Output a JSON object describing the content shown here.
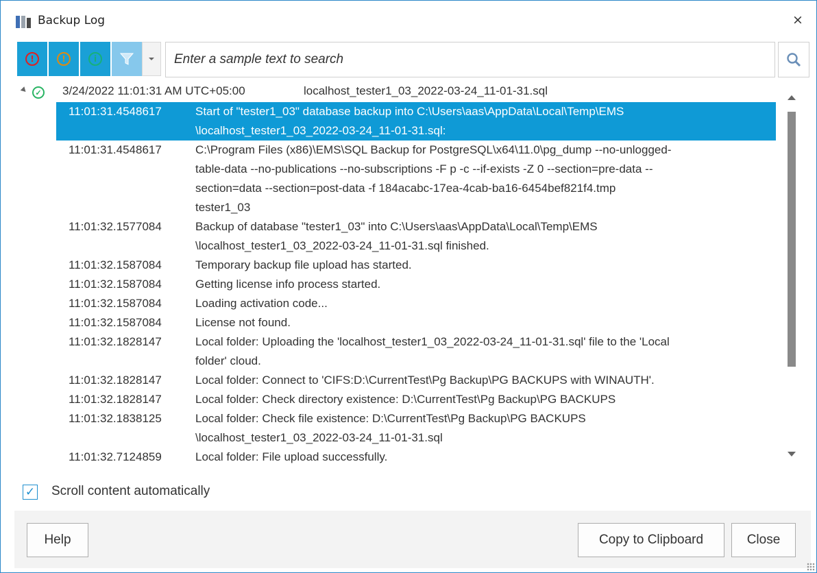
{
  "window": {
    "title": "Backup Log",
    "close_glyph": "×"
  },
  "toolbar": {
    "filters": [
      {
        "name": "error-filter-icon",
        "glyph": "!",
        "color": "#e02020"
      },
      {
        "name": "warning-filter-icon",
        "glyph": "!",
        "color": "#e08a10"
      },
      {
        "name": "info-filter-icon",
        "glyph": "i",
        "color": "#17b07a"
      }
    ],
    "search_placeholder": "Enter a sample text to search"
  },
  "log": {
    "group": {
      "date": "3/24/2022 11:01:31 AM UTC+05:00",
      "file": "localhost_tester1_03_2022-03-24_11-01-31.sql",
      "status": "success"
    },
    "entries": [
      {
        "time": "11:01:31.4548617",
        "selected": true,
        "lines": [
          "Start of \"tester1_03\" database backup into C:\\Users\\aas\\AppData\\Local\\Temp\\EMS",
          "\\localhost_tester1_03_2022-03-24_11-01-31.sql:"
        ]
      },
      {
        "time": "11:01:31.4548617",
        "lines": [
          "C:\\Program Files (x86)\\EMS\\SQL Backup for PostgreSQL\\x64\\11.0\\pg_dump --no-unlogged-",
          "table-data --no-publications --no-subscriptions -F p -c --if-exists -Z 0 --section=pre-data --",
          "section=data --section=post-data -f 184acabc-17ea-4cab-ba16-6454bef821f4.tmp",
          "tester1_03"
        ]
      },
      {
        "time": "11:01:32.1577084",
        "lines": [
          "Backup of database \"tester1_03\" into C:\\Users\\aas\\AppData\\Local\\Temp\\EMS",
          "\\localhost_tester1_03_2022-03-24_11-01-31.sql finished."
        ]
      },
      {
        "time": "11:01:32.1587084",
        "lines": [
          "Temporary backup file upload has started."
        ]
      },
      {
        "time": "11:01:32.1587084",
        "lines": [
          "Getting license info process started."
        ]
      },
      {
        "time": "11:01:32.1587084",
        "lines": [
          "Loading activation code..."
        ]
      },
      {
        "time": "11:01:32.1587084",
        "lines": [
          "License not found."
        ]
      },
      {
        "time": "11:01:32.1828147",
        "lines": [
          "Local folder: Uploading the 'localhost_tester1_03_2022-03-24_11-01-31.sql' file to the 'Local",
          "folder' cloud."
        ]
      },
      {
        "time": "11:01:32.1828147",
        "lines": [
          "Local folder: Connect to 'CIFS:D:\\CurrentTest\\Pg Backup\\PG BACKUPS with WINAUTH'."
        ]
      },
      {
        "time": "11:01:32.1828147",
        "lines": [
          "Local folder: Check directory existence: D:\\CurrentTest\\Pg Backup\\PG BACKUPS"
        ]
      },
      {
        "time": "11:01:32.1838125",
        "lines": [
          "Local folder: Check file existence: D:\\CurrentTest\\Pg Backup\\PG BACKUPS",
          "\\localhost_tester1_03_2022-03-24_11-01-31.sql"
        ]
      },
      {
        "time": "11:01:32.7124859",
        "lines": [
          "Local folder: File upload successfully."
        ]
      }
    ]
  },
  "options": {
    "scroll_auto_label": "Scroll content automatically",
    "scroll_auto_checked": true
  },
  "footer": {
    "help_label": "Help",
    "copy_label": "Copy to Clipboard",
    "close_label": "Close"
  }
}
